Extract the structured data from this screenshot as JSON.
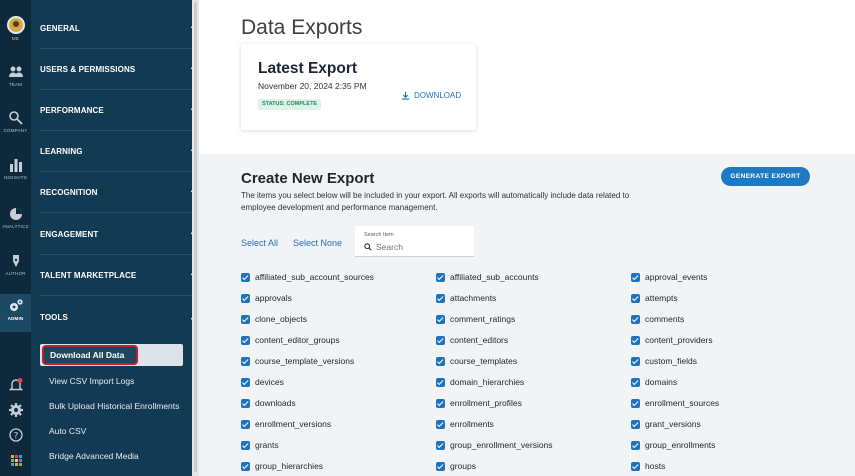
{
  "rail": {
    "items": [
      {
        "label": "ME",
        "icon": "avatar-icon"
      },
      {
        "label": "TEAM",
        "icon": "team-icon"
      },
      {
        "label": "COMPANY",
        "icon": "company-icon"
      },
      {
        "label": "INSIGHTS",
        "icon": "bar-chart-icon"
      },
      {
        "label": "ANALYTICS",
        "icon": "pie-chart-icon"
      },
      {
        "label": "AUTHOR",
        "icon": "pen-icon"
      },
      {
        "label": "ADMIN",
        "icon": "gears-icon"
      }
    ],
    "bottom_icons": [
      "notification-bell-icon",
      "settings-gear-icon",
      "help-icon",
      "app-grid-icon"
    ]
  },
  "nav": {
    "sections": [
      {
        "label": "GENERAL",
        "expanded": false
      },
      {
        "label": "USERS & PERMISSIONS",
        "expanded": false
      },
      {
        "label": "PERFORMANCE",
        "expanded": false
      },
      {
        "label": "LEARNING",
        "expanded": false
      },
      {
        "label": "RECOGNITION",
        "expanded": false
      },
      {
        "label": "ENGAGEMENT",
        "expanded": false
      },
      {
        "label": "TALENT MARKETPLACE",
        "expanded": false
      },
      {
        "label": "TOOLS",
        "expanded": true
      }
    ],
    "tools_items": [
      {
        "label": "Download All Data",
        "active": true
      },
      {
        "label": "View CSV Import Logs"
      },
      {
        "label": "Bulk Upload Historical Enrollments"
      },
      {
        "label": "Auto CSV"
      },
      {
        "label": "Bridge Advanced Media"
      }
    ]
  },
  "page": {
    "title": "Data Exports",
    "latest": {
      "title": "Latest Export",
      "date": "November 20, 2024 2:35 PM",
      "status": "STATUS: COMPLETE",
      "download_label": "DOWNLOAD"
    },
    "create": {
      "title": "Create New Export",
      "description": "The items you select below will be included in your export. All exports will automatically include data related to employee development and performance management.",
      "generate_label": "GENERATE EXPORT",
      "select_all": "Select All",
      "select_none": "Select None",
      "search_caption": "Search Item",
      "search_placeholder": "Search"
    },
    "items": [
      [
        "affiliated_sub_account_sources",
        "affiliated_sub_accounts",
        "approval_events"
      ],
      [
        "approvals",
        "attachments",
        "attempts"
      ],
      [
        "clone_objects",
        "comment_ratings",
        "comments"
      ],
      [
        "content_editor_groups",
        "content_editors",
        "content_providers"
      ],
      [
        "course_template_versions",
        "course_templates",
        "custom_fields"
      ],
      [
        "devices",
        "domain_hierarchies",
        "domains"
      ],
      [
        "downloads",
        "enrollment_profiles",
        "enrollment_sources"
      ],
      [
        "enrollment_versions",
        "enrollments",
        "grant_versions"
      ],
      [
        "grants",
        "group_enrollment_versions",
        "group_enrollments"
      ],
      [
        "group_hierarchies",
        "groups",
        "hosts"
      ]
    ]
  },
  "colors": {
    "rail_bg": "#0c2a3c",
    "nav_bg": "#123a52",
    "accent": "#1e73be",
    "highlight_border": "#c0202a"
  }
}
